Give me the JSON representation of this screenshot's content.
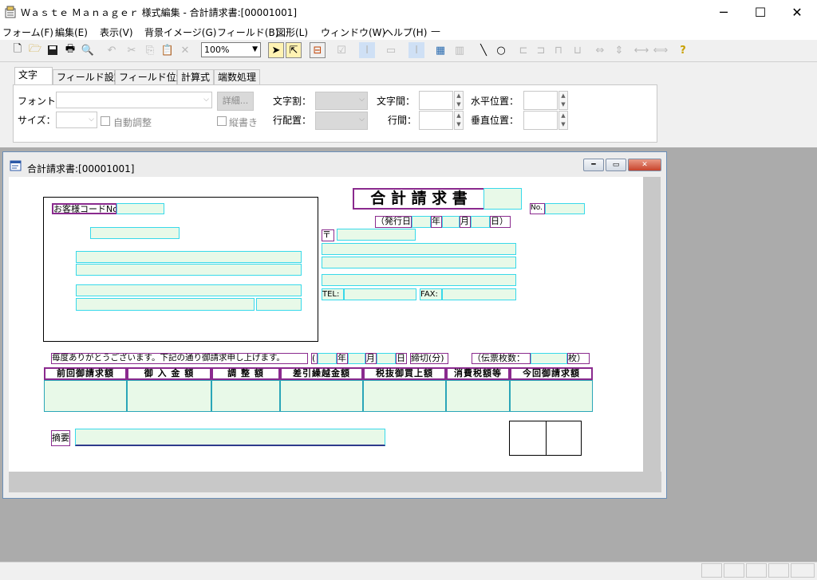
{
  "window": {
    "title": "Ｗａｓｔｅ Ｍａｎａｇｅｒ 様式編集 - 合計請求書:[00001001]"
  },
  "menu": [
    {
      "label": "フォーム(F)"
    },
    {
      "label": "編集(E)"
    },
    {
      "label": "表示(V)"
    },
    {
      "label": "背景イメージ(G)"
    },
    {
      "label": "フィールド(B)"
    },
    {
      "label": "図形(L)"
    },
    {
      "label": "ウィンドウ(W)"
    },
    {
      "label": "ヘルプ(H)"
    },
    {
      "label": "—"
    }
  ],
  "toolbar": {
    "zoom": "100%"
  },
  "tabs": [
    {
      "label": "文字"
    },
    {
      "label": "フィールド設定"
    },
    {
      "label": "フィールド位置"
    },
    {
      "label": "計算式"
    },
    {
      "label": "端数処理"
    }
  ],
  "props": {
    "font_label": "フォント：",
    "size_label": "サイズ：",
    "detail_button": "詳細...",
    "auto_adjust": "自動調整",
    "vertical": "縦書き",
    "char_split": "文字割：",
    "line_align": "行配置：",
    "char_spacing": "文字間：",
    "line_spacing": "行間：",
    "h_pos": "水平位置：",
    "v_pos": "垂直位置："
  },
  "child": {
    "title": "合計請求書:[00001001]"
  },
  "form": {
    "title": "合 計 請 求 書",
    "customer_code": "お客様コードNo",
    "no": "No.",
    "issue_date": "（発行日",
    "year": "年",
    "month": "月",
    "day": "日）",
    "postal": "〒",
    "tel": "TEL:",
    "fax": "FAX:",
    "thanks": "毎度ありがとうございます。下記の通り御請求申し上げます。",
    "paren_open": "(",
    "year2": "年",
    "month2": "月",
    "day2": "日",
    "closing": "締切(分)",
    "slip_count": "（伝票枚数：",
    "slip_unit": "枚）",
    "headers": [
      "前回御請求額",
      "御 入 金 額",
      "調 整 額",
      "差引繰越金額",
      "税抜御買上額",
      "消費税額等",
      "今回御請求額"
    ],
    "summary": "摘要"
  }
}
